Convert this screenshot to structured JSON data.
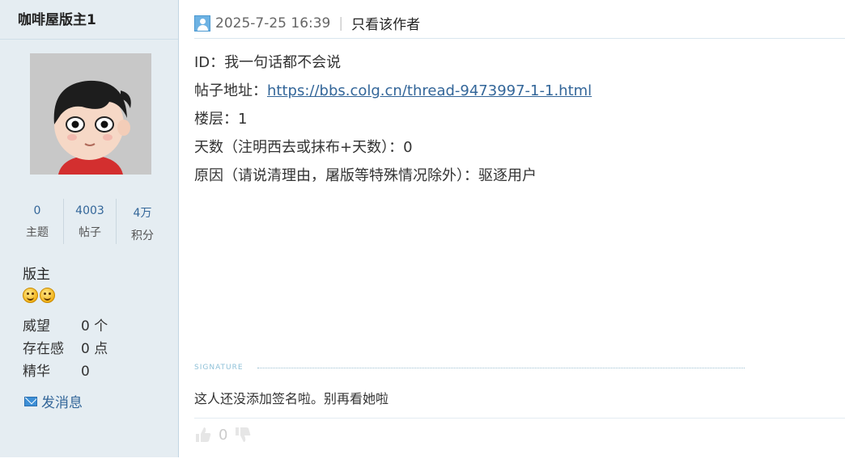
{
  "author": {
    "name": "咖啡屋版主1",
    "stats": [
      {
        "value": "0",
        "label": "主题"
      },
      {
        "value": "4003",
        "label": "帖子"
      },
      {
        "value": "4万",
        "label": "积分"
      }
    ],
    "group": "版主",
    "attributes": [
      {
        "key": "威望",
        "value": "0 个"
      },
      {
        "key": "存在感",
        "value": "0 点"
      },
      {
        "key": "精华",
        "value": "0"
      }
    ],
    "send_message": "发消息"
  },
  "post": {
    "time": "2025-7-25 16:39",
    "separator": "|",
    "only_author": "只看该作者",
    "lines": {
      "id": "ID：我一句话都不会说",
      "url_label": "帖子地址：",
      "url": "https://bbs.colg.cn/thread-9473997-1-1.html",
      "floor": "楼层：1",
      "days": "天数（注明西去或抹布+天数）：0",
      "reason": "原因（请说清理由，屠版等特殊情况除外）：驱逐用户"
    },
    "signature_label": "SIGNATURE",
    "signature": "这人还没添加签名啦。别再看她啦",
    "vote_count": "0"
  },
  "icons": {
    "user": "user-icon",
    "mail": "mail-icon",
    "thumb_up": "thumb-up-icon",
    "thumb_down": "thumb-down-icon",
    "smiley": "smiley-icon"
  }
}
